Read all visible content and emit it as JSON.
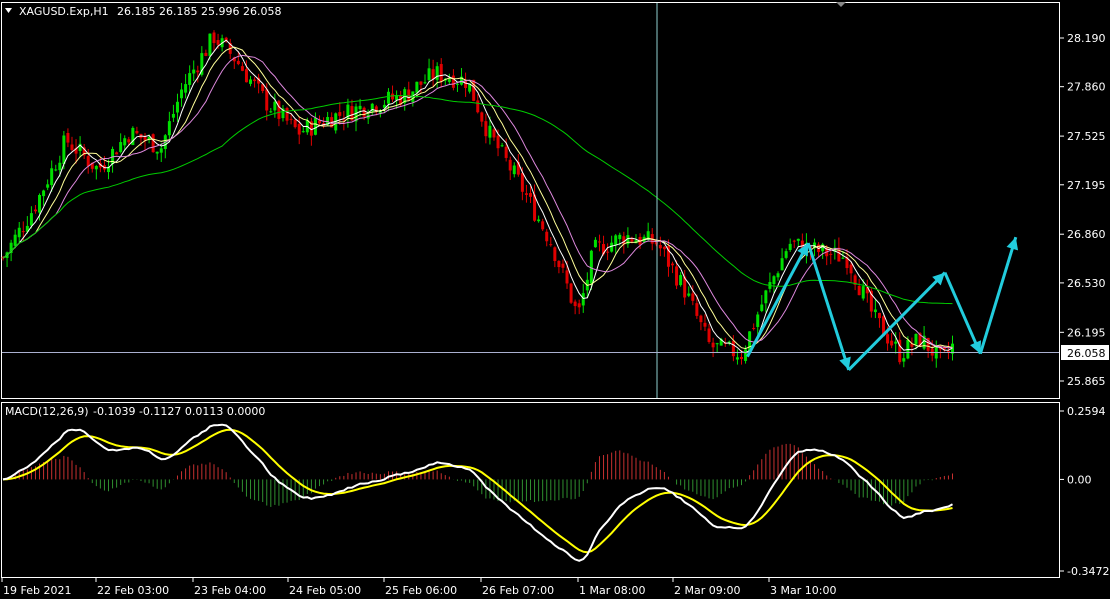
{
  "header": {
    "symbol": "XAGUSD.Exp,H1",
    "ohlc": "26.185 26.185 25.996 26.058"
  },
  "macd": {
    "label": "MACD(12,26,9)",
    "values": "-0.1039 -0.1127 0.0113 0.0000",
    "axis_ticks": [
      "0.2594",
      "0.00",
      "-0.3472"
    ]
  },
  "price_axis": {
    "ticks": [
      "28.190",
      "27.860",
      "27.525",
      "27.195",
      "26.860",
      "26.530",
      "26.195",
      "25.865"
    ],
    "current": "26.058"
  },
  "time_axis": {
    "labels": [
      "19 Feb 2021",
      "22 Feb 03:00",
      "23 Feb 04:00",
      "24 Feb 05:00",
      "25 Feb 06:00",
      "26 Feb 07:00",
      "1 Mar 08:00",
      "2 Mar 09:00",
      "3 Mar 10:00"
    ]
  },
  "colors": {
    "background": "#000000",
    "bull": "#00e000",
    "bear": "#e00000",
    "ma_fast": "#ffffff",
    "ma_mid": "#ffff99",
    "ma_slow": "#dd88dd",
    "ma_long": "#00cc00",
    "macd_line": "#ffffff",
    "signal_line": "#ffff00",
    "hist_pos": "#c83030",
    "hist_neg": "#2f8f2f",
    "projection": "#22ccdd",
    "grid": "#ffffff"
  },
  "chart_data": {
    "type": "candlestick",
    "symbol": "XAGUSD.Exp",
    "timeframe": "H1",
    "last_ohlc": {
      "open": 26.185,
      "high": 26.185,
      "low": 25.996,
      "close": 26.058
    },
    "current_price": 26.058,
    "price_range": [
      25.75,
      28.35
    ],
    "close_path": [
      {
        "t": 0.0,
        "p": 26.7
      },
      {
        "t": 0.03,
        "p": 27.05
      },
      {
        "t": 0.06,
        "p": 27.5
      },
      {
        "t": 0.09,
        "p": 27.3
      },
      {
        "t": 0.12,
        "p": 27.55
      },
      {
        "t": 0.15,
        "p": 27.45
      },
      {
        "t": 0.17,
        "p": 27.85
      },
      {
        "t": 0.2,
        "p": 28.2
      },
      {
        "t": 0.22,
        "p": 28.05
      },
      {
        "t": 0.25,
        "p": 27.75
      },
      {
        "t": 0.28,
        "p": 27.55
      },
      {
        "t": 0.31,
        "p": 27.65
      },
      {
        "t": 0.34,
        "p": 27.72
      },
      {
        "t": 0.38,
        "p": 27.8
      },
      {
        "t": 0.41,
        "p": 27.95
      },
      {
        "t": 0.44,
        "p": 27.9
      },
      {
        "t": 0.46,
        "p": 27.55
      },
      {
        "t": 0.49,
        "p": 27.2
      },
      {
        "t": 0.52,
        "p": 26.8
      },
      {
        "t": 0.545,
        "p": 26.3
      },
      {
        "t": 0.56,
        "p": 26.75
      },
      {
        "t": 0.59,
        "p": 26.85
      },
      {
        "t": 0.62,
        "p": 26.8
      },
      {
        "t": 0.645,
        "p": 26.5
      },
      {
        "t": 0.67,
        "p": 26.1
      },
      {
        "t": 0.7,
        "p": 26.05
      },
      {
        "t": 0.72,
        "p": 26.4
      },
      {
        "t": 0.745,
        "p": 26.8
      },
      {
        "t": 0.77,
        "p": 26.75
      },
      {
        "t": 0.8,
        "p": 26.7
      },
      {
        "t": 0.825,
        "p": 26.3
      },
      {
        "t": 0.85,
        "p": 26.05
      },
      {
        "t": 0.87,
        "p": 26.15
      },
      {
        "t": 0.89,
        "p": 26.0
      },
      {
        "t": 0.9,
        "p": 26.1
      }
    ],
    "moving_averages": [
      "ma_fast",
      "ma_mid",
      "ma_slow",
      "ma_long"
    ],
    "projection_path": [
      {
        "t": 0.735,
        "p": 26.03
      },
      {
        "t": 0.795,
        "p": 26.8
      },
      {
        "t": 0.835,
        "p": 25.94
      },
      {
        "t": 0.93,
        "p": 26.6
      },
      {
        "t": 0.965,
        "p": 26.05
      },
      {
        "t": 1.0,
        "p": 26.84
      }
    ],
    "macd": {
      "macd": -0.1039,
      "signal": -0.1127,
      "histogram": 0.0113,
      "extra": 0.0,
      "range": [
        -0.3472,
        0.2594
      ]
    }
  }
}
